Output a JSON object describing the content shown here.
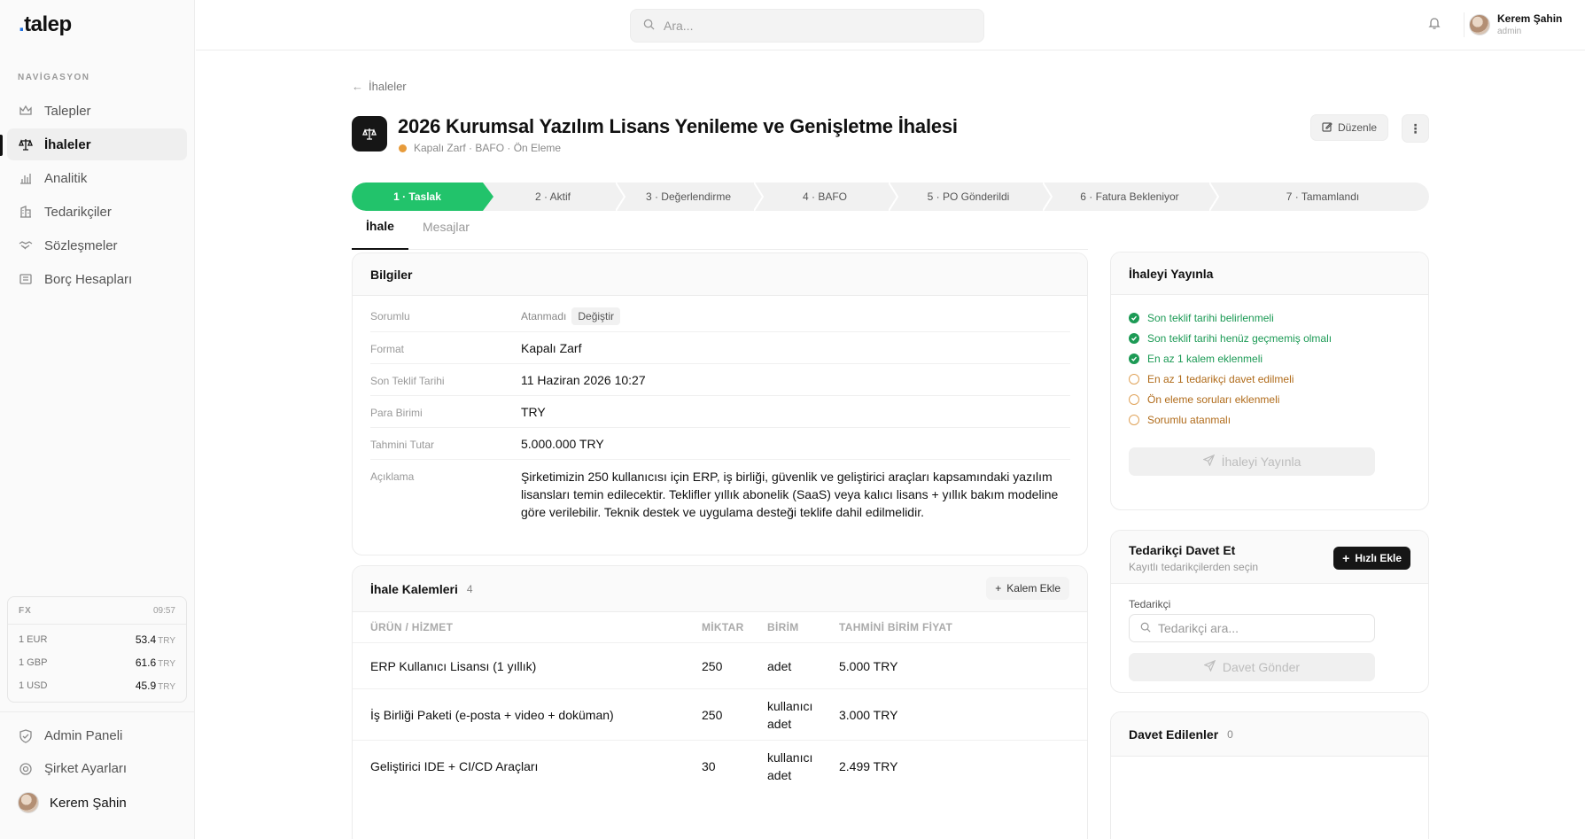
{
  "app": {
    "logo_text": "talep"
  },
  "sidebar": {
    "section_label": "NAVİGASYON",
    "items": [
      {
        "label": "Talepler",
        "icon": "crown-icon"
      },
      {
        "label": "İhaleler",
        "icon": "scale-icon",
        "active": true
      },
      {
        "label": "Analitik",
        "icon": "bar-chart-icon"
      },
      {
        "label": "Tedarikçiler",
        "icon": "building-icon"
      },
      {
        "label": "Sözleşmeler",
        "icon": "handshake-icon"
      },
      {
        "label": "Borç Hesapları",
        "icon": "ledger-icon"
      }
    ],
    "fx": {
      "label": "FX",
      "time": "09:57",
      "rows": [
        {
          "pair": "1 EUR",
          "value": "53.4",
          "currency": "TRY"
        },
        {
          "pair": "1 GBP",
          "value": "61.6",
          "currency": "TRY"
        },
        {
          "pair": "1 USD",
          "value": "45.9",
          "currency": "TRY"
        }
      ]
    },
    "bottom": [
      {
        "label": "Admin Paneli",
        "icon": "shield-icon"
      },
      {
        "label": "Şirket Ayarları",
        "icon": "gear-icon"
      }
    ],
    "user": {
      "name": "Kerem Şahin"
    }
  },
  "topbar": {
    "search_placeholder": "Ara...",
    "user_name": "Kerem Şahin",
    "user_role": "admin"
  },
  "page": {
    "breadcrumb": "İhaleler",
    "title": "2026 Kurumsal Yazılım Lisans Yenileme ve Genişletme İhalesi",
    "subtitle": "Kapalı Zarf · BAFO · Ön Eleme",
    "edit_label": "Düzenle",
    "more_label": "⋮",
    "steps": [
      "1 · Taslak",
      "2 · Aktif",
      "3 · Değerlendirme",
      "4 · BAFO",
      "5 · PO Gönderildi",
      "6 · Fatura Bekleniyor",
      "7 · Tamamlandı"
    ],
    "tabs": [
      "İhale",
      "Mesajlar"
    ]
  },
  "info": {
    "title": "Bilgiler",
    "rows": [
      {
        "label": "Sorumlu",
        "value": "Atanmadı",
        "action": "Değiştir"
      },
      {
        "label": "Format",
        "value": "Kapalı Zarf"
      },
      {
        "label": "Son Teklif Tarihi",
        "value": "11 Haziran 2026 10:27"
      },
      {
        "label": "Para Birimi",
        "value": "TRY"
      },
      {
        "label": "Tahmini Tutar",
        "value": "5.000.000 TRY"
      },
      {
        "label": "Açıklama",
        "value": "Şirketimizin 250 kullanıcısı için ERP, iş birliği, güvenlik ve geliştirici araçları kapsamındaki yazılım lisansları temin edilecektir. Teklifler yıllık abonelik (SaaS) veya kalıcı lisans + yıllık bakım modeline göre verilebilir. Teknik destek ve uygulama desteği teklife dahil edilmelidir."
      }
    ]
  },
  "items": {
    "title": "İhale Kalemleri",
    "count": "4",
    "add_label": "Kalem Ekle",
    "columns": [
      "ÜRÜN / HİZMET",
      "MİKTAR",
      "BİRİM",
      "TAHMİNİ BİRİM FİYAT"
    ],
    "rows": [
      {
        "product": "ERP Kullanıcı Lisansı (1 yıllık)",
        "qty": "250",
        "unit": "adet",
        "price": "5.000 TRY"
      },
      {
        "product": "İş Birliği Paketi (e-posta + video + doküman)",
        "qty": "250",
        "unit": "kullanıcı adet",
        "price": "3.000 TRY"
      },
      {
        "product": "Geliştirici IDE + CI/CD Araçları",
        "qty": "30",
        "unit": "kullanıcı adet",
        "price": "2.499 TRY"
      }
    ]
  },
  "publish": {
    "title": "İhaleyi Yayınla",
    "checklist": [
      {
        "text": "Son teklif tarihi belirlenmeli",
        "done": true
      },
      {
        "text": "Son teklif tarihi henüz geçmemiş olmalı",
        "done": true
      },
      {
        "text": "En az 1 kalem eklenmeli",
        "done": true
      },
      {
        "text": "En az 1 tedarikçi davet edilmeli",
        "done": false
      },
      {
        "text": "Ön eleme soruları eklenmeli",
        "done": false
      },
      {
        "text": "Sorumlu atanmalı",
        "done": false
      }
    ],
    "button_label": "İhaleyi Yayınla"
  },
  "invite": {
    "title": "Tedarikçi Davet Et",
    "subtitle": "Kayıtlı tedarikçilerden seçin",
    "quick_add": "Hızlı Ekle",
    "field_label": "Tedarikçi",
    "placeholder": "Tedarikçi ara...",
    "button_label": "Davet Gönder"
  },
  "invited": {
    "title": "Davet Edilenler",
    "count": "0"
  },
  "colors": {
    "accent_green": "#22c36b",
    "success": "#1c9a55",
    "warning": "#e0a35a",
    "dark": "#161616"
  }
}
